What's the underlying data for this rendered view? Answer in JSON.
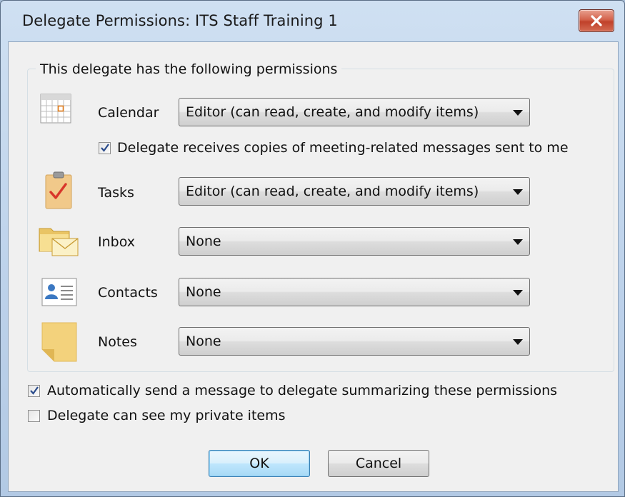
{
  "window": {
    "title": "Delegate Permissions: ITS Staff Training 1"
  },
  "group": {
    "label": "This delegate has the following permissions"
  },
  "rows": {
    "calendar": {
      "label": "Calendar",
      "value": "Editor (can read, create, and modify items)"
    },
    "meeting_copies": {
      "label": "Delegate receives copies of meeting-related messages sent to me",
      "checked": true
    },
    "tasks": {
      "label": "Tasks",
      "value": "Editor (can read, create, and modify items)"
    },
    "inbox": {
      "label": "Inbox",
      "value": "None"
    },
    "contacts": {
      "label": "Contacts",
      "value": "None"
    },
    "notes": {
      "label": "Notes",
      "value": "None"
    }
  },
  "options": {
    "auto_send": {
      "label": "Automatically send a message to delegate summarizing these permissions",
      "checked": true
    },
    "private_items": {
      "label": "Delegate can see my private items",
      "checked": false
    }
  },
  "buttons": {
    "ok": "OK",
    "cancel": "Cancel"
  },
  "colors": {
    "title_bar": "#bcd1ea",
    "close_button": "#c9503a",
    "dialog_bg": "#f0f0f0",
    "default_button": "#bee6fd"
  }
}
